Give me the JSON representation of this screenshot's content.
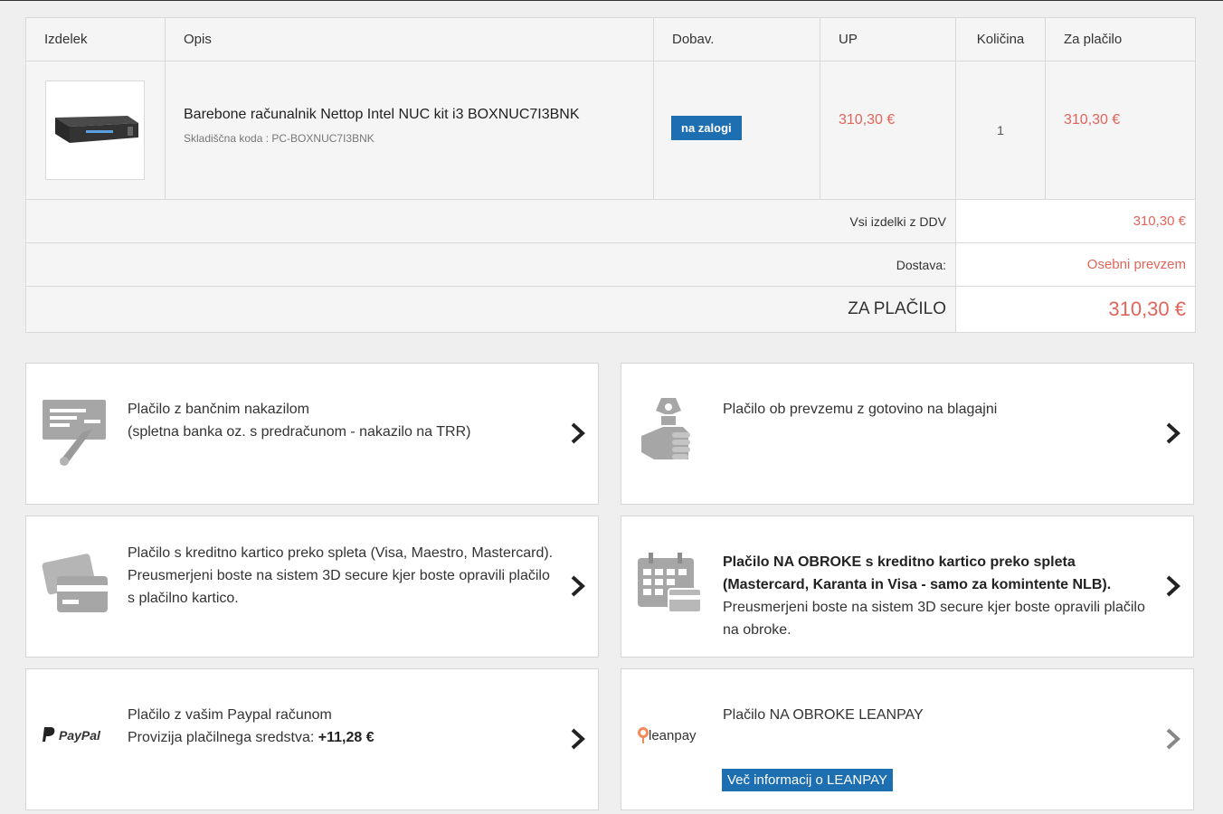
{
  "table": {
    "headers": {
      "product": "Izdelek",
      "description": "Opis",
      "availability": "Dobav.",
      "unit_price": "UP",
      "quantity": "Količina",
      "to_pay": "Za plačilo"
    },
    "item": {
      "name": "Barebone računalnik Nettop Intel NUC kit i3 BOXNUC7I3BNK",
      "code": "Skladiščna koda : PC-BOXNUC7I3BNK",
      "availability": "na zalogi",
      "unit_price": "310,30 €",
      "quantity": "1",
      "total": "310,30 €"
    },
    "summary": {
      "subtotal_label": "Vsi izdelki z DDV",
      "subtotal_value": "310,30 €",
      "shipping_label": "Dostava:",
      "shipping_value": "Osebni prevzem",
      "total_label": "ZA PLAČILO",
      "total_value": "310,30 €"
    }
  },
  "payments": {
    "bank": {
      "line1": "Plačilo z bančnim nakazilom",
      "line2": "(spletna banka oz. s predračunom - nakazilo na TRR)",
      "icon": "bank-transfer-icon"
    },
    "cash": {
      "line1": "Plačilo ob prevzemu z gotovino na blagajni",
      "icon": "cash-hand-icon"
    },
    "card": {
      "text": "Plačilo s kreditno kartico preko spleta (Visa, Maestro, Mastercard). Preusmerjeni boste na sistem 3D secure kjer boste opravili plačilo s plačilno kartico.",
      "icon": "credit-card-icon"
    },
    "installments": {
      "bold": "Plačilo NA OBROKE s kreditno kartico preko spleta (Mastercard, Karanta in Visa - samo za komintente NLB).",
      "rest": " Preusmerjeni boste na sistem 3D secure kjer boste opravili plačilo na obroke.",
      "icon": "calendar-card-icon"
    },
    "paypal": {
      "line1": "Plačilo z vašim Paypal računom",
      "line2_prefix": "Provizija plačilnega sredstva: ",
      "fee": "+11,28 €",
      "logo": "PayPal",
      "icon": "paypal-logo"
    },
    "leanpay": {
      "line1": "Plačilo NA OBROKE LEANPAY",
      "link": "Več informacij o LEANPAY",
      "logo": "leanpay",
      "icon": "leanpay-logo"
    }
  },
  "colors": {
    "accent_blue": "#1e6fb2",
    "price_red": "#e0645a",
    "icon_gray": "#9a9a9a"
  }
}
